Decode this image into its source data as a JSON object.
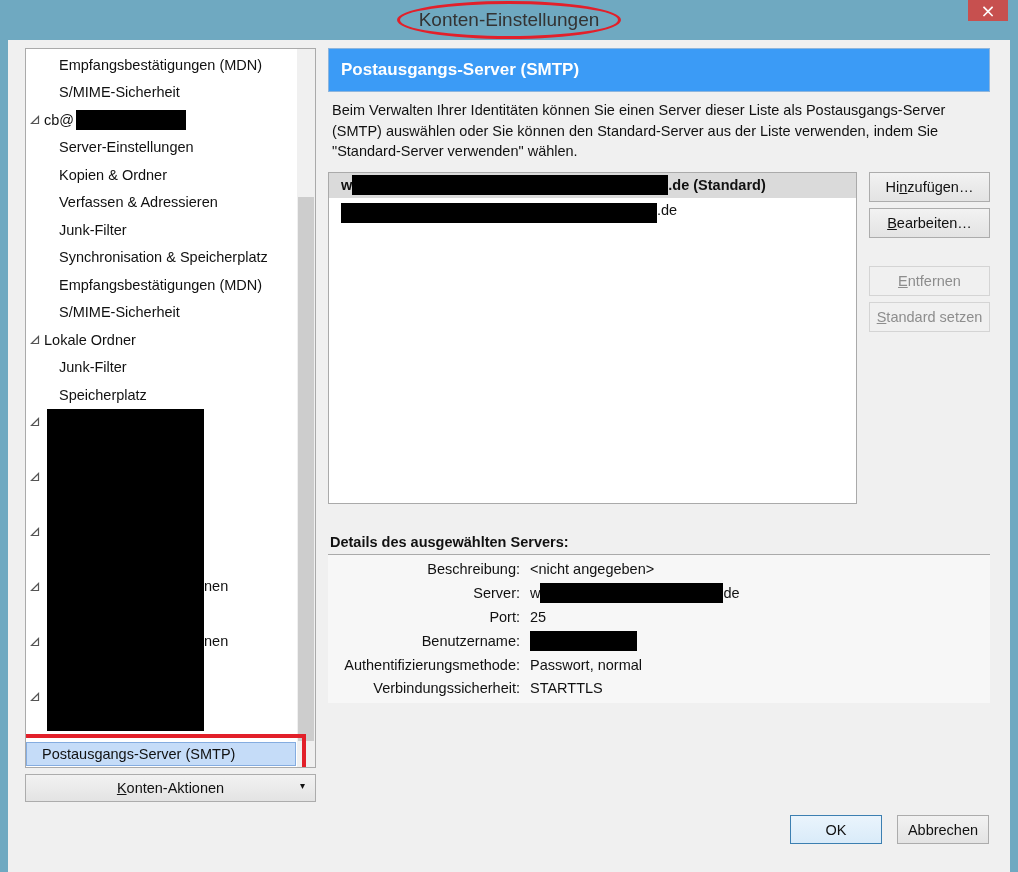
{
  "window": {
    "title": "Konten-Einstellungen",
    "close": "×",
    "title_annotation": true
  },
  "tree": {
    "redaction_block": true,
    "items": [
      {
        "kind": "page",
        "label": "Empfangsbestätigungen (MDN)",
        "selected": false
      },
      {
        "kind": "page",
        "label": "S/MIME-Sicherheit",
        "selected": false
      },
      {
        "kind": "account",
        "label": "cb@",
        "redacted": true,
        "expanded": true,
        "selected": false,
        "children": [
          {
            "kind": "page",
            "label": "Server-Einstellungen",
            "selected": false
          },
          {
            "kind": "page",
            "label": "Kopien & Ordner",
            "selected": false
          },
          {
            "kind": "page",
            "label": "Verfassen & Adressieren",
            "selected": false
          },
          {
            "kind": "page",
            "label": "Junk-Filter",
            "selected": false
          },
          {
            "kind": "page",
            "label": "Synchronisation & Speicherplatz",
            "selected": false
          },
          {
            "kind": "page",
            "label": "Empfangsbestätigungen (MDN)",
            "selected": false
          },
          {
            "kind": "page",
            "label": "S/MIME-Sicherheit",
            "selected": false
          }
        ]
      },
      {
        "kind": "account",
        "label": "Lokale Ordner",
        "expanded": true,
        "selected": false,
        "children": [
          {
            "kind": "page",
            "label": "Junk-Filter",
            "selected": false
          },
          {
            "kind": "page",
            "label": "Speicherplatz",
            "selected": false
          }
        ]
      },
      {
        "kind": "covered",
        "expanded": true
      },
      {
        "kind": "covered",
        "expanded": true
      },
      {
        "kind": "covered",
        "expanded": true
      },
      {
        "kind": "covered",
        "tail": "nen",
        "expanded": true
      },
      {
        "kind": "covered",
        "tail": "nen",
        "expanded": true
      },
      {
        "kind": "covered",
        "expanded": true
      },
      {
        "kind": "root",
        "label": "Postausgangs-Server (SMTP)",
        "selected": true,
        "annotated": true
      }
    ]
  },
  "account_actions": {
    "label": {
      "key": "K",
      "post": "onten-Aktionen"
    },
    "caret": "▾"
  },
  "header": "Postausgangs-Server (SMTP)",
  "description": "Beim Verwalten Ihrer Identitäten können Sie einen Server dieser Liste als Postausgangs-Server (SMTP) auswählen oder Sie können den Standard-Server aus der Liste verwenden, indem Sie \"Standard-Server verwenden\" wählen.",
  "servers": [
    {
      "prefix": "w",
      "suffix": ".de (Standard)",
      "default": true,
      "selected": true
    },
    {
      "suffix": ".de",
      "default": false,
      "selected": false
    }
  ],
  "server_buttons": [
    {
      "label": {
        "pre": "Hi",
        "key": "n",
        "post": "zufügen…"
      },
      "disabled": false
    },
    {
      "label": {
        "key": "B",
        "post": "earbeiten…"
      },
      "disabled": false
    },
    {
      "label": {
        "key": "E",
        "post": "ntfernen"
      },
      "disabled": true
    },
    {
      "label": {
        "key": "S",
        "post": "tandard setzen"
      },
      "disabled": true
    }
  ],
  "details": {
    "title": "Details des ausgewählten Servers:",
    "rows": [
      {
        "label": "Beschreibung:",
        "value": "<nicht angegeben>"
      },
      {
        "label": "Server:",
        "value": "w",
        "tail": "de",
        "redacted": true
      },
      {
        "label": "Port:",
        "value": "25"
      },
      {
        "label": "Benutzername:",
        "redacted": true
      },
      {
        "label": "Authentifizierungsmethode:",
        "value": "Passwort, normal"
      },
      {
        "label": "Verbindungssicherheit:",
        "value": "STARTTLS"
      }
    ]
  },
  "dialog_buttons": [
    {
      "label": "OK",
      "default": true
    },
    {
      "label": "Abbrechen",
      "default": false
    }
  ]
}
